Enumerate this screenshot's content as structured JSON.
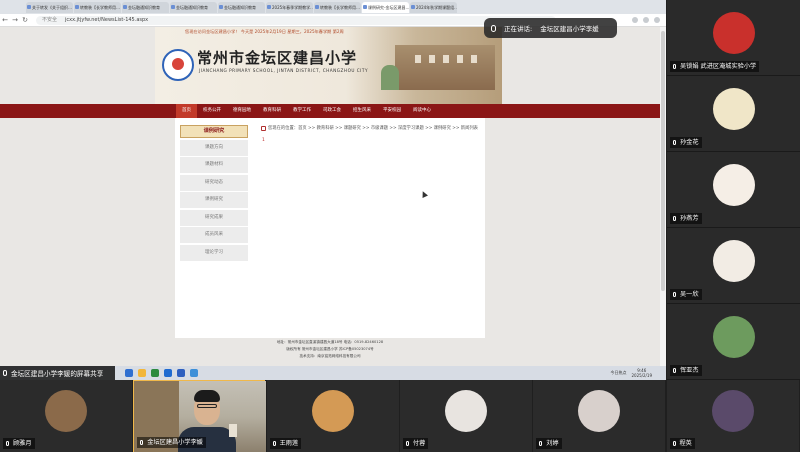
{
  "browser": {
    "tabs": [
      "关于转发《关于组织…",
      "转教装【长学教师用…",
      "金坛融通知识教育",
      "金坛融通知识教育",
      "金坛融通知识教育",
      "2025年春季学期教学…",
      "转教装【长学教师用…",
      "课例研究-金坛区建昌…",
      "2024年秋学期课题组…"
    ],
    "active_tab_index": 7,
    "security_label": "不安全",
    "url": "jcxx.jtjyfw.net/NewsList-145.aspx"
  },
  "site": {
    "top_notice": "您现在访问金坛区建昌小学！ 今天是 2025年2月19日 星期三，2025年春学期 第2周",
    "school_name": "常州市金坛区建昌小学",
    "school_name_en": "JIANCHANG PRIMARY SCHOOL, JINTAN DISTRICT, CHANGZHOU CITY",
    "nav": [
      "首页",
      "校务公开",
      "德育园地",
      "教育科研",
      "教学工作",
      "司政工会",
      "招生风采",
      "平安校园",
      "阅读中心"
    ],
    "active_nav_index": 0,
    "sidebar_title": "课例研究",
    "sidebar_items": [
      "课题方向",
      "课题材料",
      "研究动态",
      "课例研究",
      "研究成果",
      "成员风采",
      "理论学习"
    ],
    "breadcrumb": "您现在的位置：首页 >> 教育科研 >> 课题研究 >> 市级课题 >> 深度学习课题 >> 课例研究 >> 新闻列表",
    "page_number": "1",
    "footer_lines": [
      "地址：常州市金坛区直溪镇建昌大道18号  电话：0519-82460128",
      "版权所有 常州市金坛区建昌小学 苏ICP备05023074号",
      "技术支持：南京铭拓网络科技有限公司"
    ]
  },
  "speaking_indicator": {
    "label": "正在讲话:",
    "speaker": "金坛区建昌小学李媛"
  },
  "screen_share_banner": "金坛区建昌小学李媛的屏幕共享",
  "taskbar": {
    "news_label": "今日热点",
    "time": "9:46",
    "date": "2025/2/19"
  },
  "right_participants": [
    {
      "name": "吴锁娟 武进区淹城实验小学",
      "avatar_color": "#c9302c"
    },
    {
      "name": "孙金花",
      "avatar_color": "#f0e6c8"
    },
    {
      "name": "孙燕芳",
      "avatar_color": "#f5eee6"
    },
    {
      "name": "吴一欣",
      "avatar_color": "#f2ece4"
    },
    {
      "name": "恽亚杰",
      "avatar_color": "#6d9b5e"
    }
  ],
  "bottom_participants": [
    {
      "name": "顾雅月",
      "avatar_color": "#8b6a4a"
    },
    {
      "name": "金坛区建昌小学李媛",
      "avatar_color": "#b4ae9f"
    },
    {
      "name": "王雨莲",
      "avatar_color": "#d49a55"
    },
    {
      "name": "付蓉",
      "avatar_color": "#e8e4e0"
    },
    {
      "name": "刘婷",
      "avatar_color": "#d8d0cc"
    },
    {
      "name": "程英",
      "avatar_color": "#5a4a6a"
    }
  ]
}
